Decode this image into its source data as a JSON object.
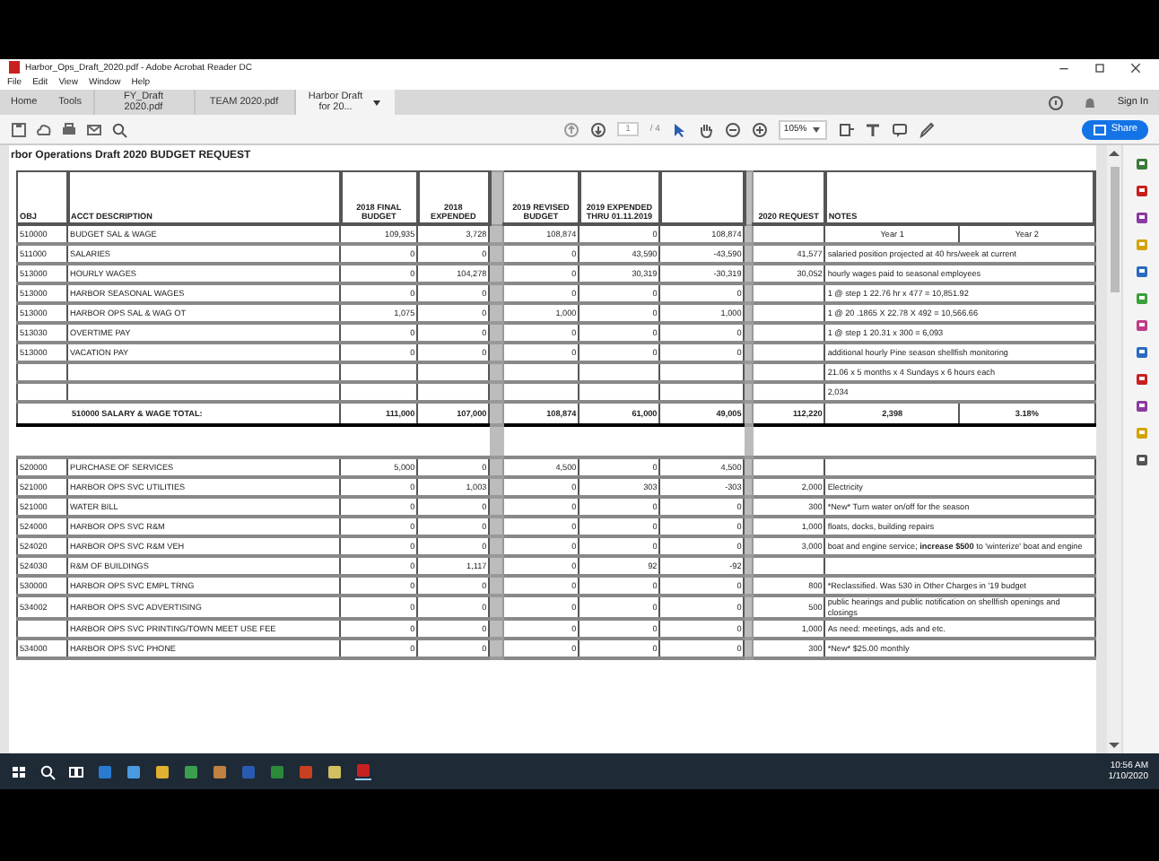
{
  "window": {
    "title": "Harbor_Ops_Draft_2020.pdf - Adobe Acrobat Reader DC"
  },
  "menu": [
    "File",
    "Edit",
    "View",
    "Window",
    "Help"
  ],
  "tabs": [
    {
      "label": "Home",
      "selected": false,
      "kind": "nav"
    },
    {
      "label": "Tools",
      "selected": false,
      "kind": "nav"
    },
    {
      "label": "FY_Draft 2020.pdf",
      "selected": false,
      "kind": "doc"
    },
    {
      "label": "TEAM 2020.pdf",
      "selected": false,
      "kind": "doc"
    },
    {
      "label": "Harbor Draft for 20...",
      "selected": true,
      "kind": "doc"
    }
  ],
  "sign_in": "Sign In",
  "toolbar": {
    "page": "1",
    "page_count": "/ 4",
    "zoom": "105%",
    "share": "Share"
  },
  "document": {
    "title": "rbor Operations Draft 2020 BUDGET REQUEST",
    "columns": [
      "OBJ",
      "ACCT DESCRIPTION",
      "2018 FINAL BUDGET",
      "2018 EXPENDED",
      "2019 REVISED BUDGET",
      "2019 EXPENDED THRU 01.11.2019",
      "2020 REQUEST",
      "NOTES"
    ],
    "rows": [
      {
        "kind": "item",
        "obj": "510000",
        "description": "BUDGET SAL & WAGE",
        "values": [
          "109,935",
          "3,728",
          "108,874",
          "0",
          "108,874"
        ],
        "notes": [
          "Year 1",
          "Year 2"
        ]
      },
      {
        "kind": "item",
        "obj": "511000",
        "description": "SALARIES",
        "values": [
          "0",
          "0",
          "0",
          "43,590",
          "-43,590"
        ],
        "request": "41,577",
        "notes": [
          "salaried position projected at 40 hrs/week at current"
        ]
      },
      {
        "kind": "item",
        "obj": "513000",
        "description": "HOURLY WAGES",
        "values": [
          "0",
          "104,278",
          "0",
          "30,319",
          "-30,319"
        ],
        "request": "30,052",
        "notes": [
          "hourly wages paid to seasonal employees"
        ]
      },
      {
        "kind": "item",
        "obj": "513000",
        "description": "HARBOR SEASONAL WAGES",
        "values": [
          "0",
          "0",
          "0",
          "0",
          "0"
        ],
        "notes": [
          "1 @ step 1 22.76 hr x 477 = 10,851.92"
        ]
      },
      {
        "kind": "item",
        "obj": "513000",
        "description": "HARBOR OPS SAL & WAG OT",
        "values": [
          "1,075",
          "0",
          "1,000",
          "0",
          "1,000"
        ],
        "notes": [
          "1 @ 20 .1865 X 22.78 X 492 = 10,566.66"
        ]
      },
      {
        "kind": "item",
        "obj": "513030",
        "description": "OVERTIME PAY",
        "values": [
          "0",
          "0",
          "0",
          "0",
          "0"
        ],
        "notes": [
          "1 @ step 1 20.31 x 300 = 6,093"
        ]
      },
      {
        "kind": "item",
        "obj": "513000",
        "description": "VACATION PAY",
        "values": [
          "0",
          "0",
          "0",
          "0",
          "0"
        ],
        "notes": [
          "additional hourly Pine season shellfish monitoring"
        ]
      },
      {
        "kind": "note",
        "notes": [
          "21.06 x 5 months x 4 Sundays x 6 hours each"
        ]
      },
      {
        "kind": "note",
        "notes": [
          "2,034"
        ]
      },
      {
        "kind": "total",
        "description": "510000 SALARY & WAGE TOTAL:",
        "values": [
          "111,000",
          "107,000",
          "108,874",
          "61,000",
          "49,005"
        ],
        "request": "112,220",
        "notes": [
          "2,398",
          "3.18%"
        ]
      },
      {
        "kind": "blank"
      },
      {
        "kind": "item",
        "obj": "520000",
        "description": "PURCHASE OF SERVICES",
        "values": [
          "5,000",
          "0",
          "4,500",
          "0",
          "4,500"
        ]
      },
      {
        "kind": "item",
        "obj": "521000",
        "description": "HARBOR OPS SVC UTILITIES",
        "values": [
          "0",
          "1,003",
          "0",
          "303",
          "-303"
        ],
        "request": "2,000",
        "notes": [
          "Electricity"
        ]
      },
      {
        "kind": "item",
        "obj": "521000",
        "description": "WATER BILL",
        "values": [
          "0",
          "0",
          "0",
          "0",
          "0"
        ],
        "request": "300",
        "notes": [
          "*New* Turn water on/off for the season"
        ]
      },
      {
        "kind": "item",
        "obj": "524000",
        "description": "HARBOR OPS SVC R&M",
        "values": [
          "0",
          "0",
          "0",
          "0",
          "0"
        ],
        "request": "1,000",
        "notes": [
          "floats, docks, building repairs"
        ]
      },
      {
        "kind": "item",
        "obj": "524020",
        "description": "HARBOR OPS SVC R&M VEH",
        "values": [
          "0",
          "0",
          "0",
          "0",
          "0"
        ],
        "request": "3,000",
        "rich": true,
        "notes": [
          "boat and engine service; **increase $500** to 'winterize' boat and engine"
        ]
      },
      {
        "kind": "item",
        "obj": "524030",
        "description": "R&M OF BUILDINGS",
        "values": [
          "0",
          "1,117",
          "0",
          "92",
          "-92"
        ]
      },
      {
        "kind": "item",
        "obj": "530000",
        "description": "HARBOR OPS SVC EMPL TRNG",
        "values": [
          "0",
          "0",
          "0",
          "0",
          "0"
        ],
        "request": "800",
        "notes": [
          "*Reclassified. Was 530 in Other Charges in '19 budget"
        ]
      },
      {
        "kind": "item",
        "obj": "534002",
        "description": "HARBOR OPS SVC ADVERTISING",
        "values": [
          "0",
          "0",
          "0",
          "0",
          "0"
        ],
        "request": "500",
        "notes": [
          "public hearings and public notification on shellfish openings and closings"
        ]
      },
      {
        "kind": "item",
        "description": "HARBOR OPS SVC PRINTING/TOWN MEET USE FEE",
        "values": [
          "0",
          "0",
          "0",
          "0",
          "0"
        ],
        "request": "1,000",
        "notes": [
          "As need: meetings, ads and etc."
        ]
      },
      {
        "kind": "item",
        "obj": "534000",
        "description": "HARBOR OPS SVC PHONE",
        "values": [
          "0",
          "0",
          "0",
          "0",
          "0"
        ],
        "request": "300",
        "notes": [
          "*New* $25.00 monthly"
        ]
      }
    ]
  },
  "taskbar": {
    "time": "10:56 AM",
    "date": "1/10/2020"
  }
}
